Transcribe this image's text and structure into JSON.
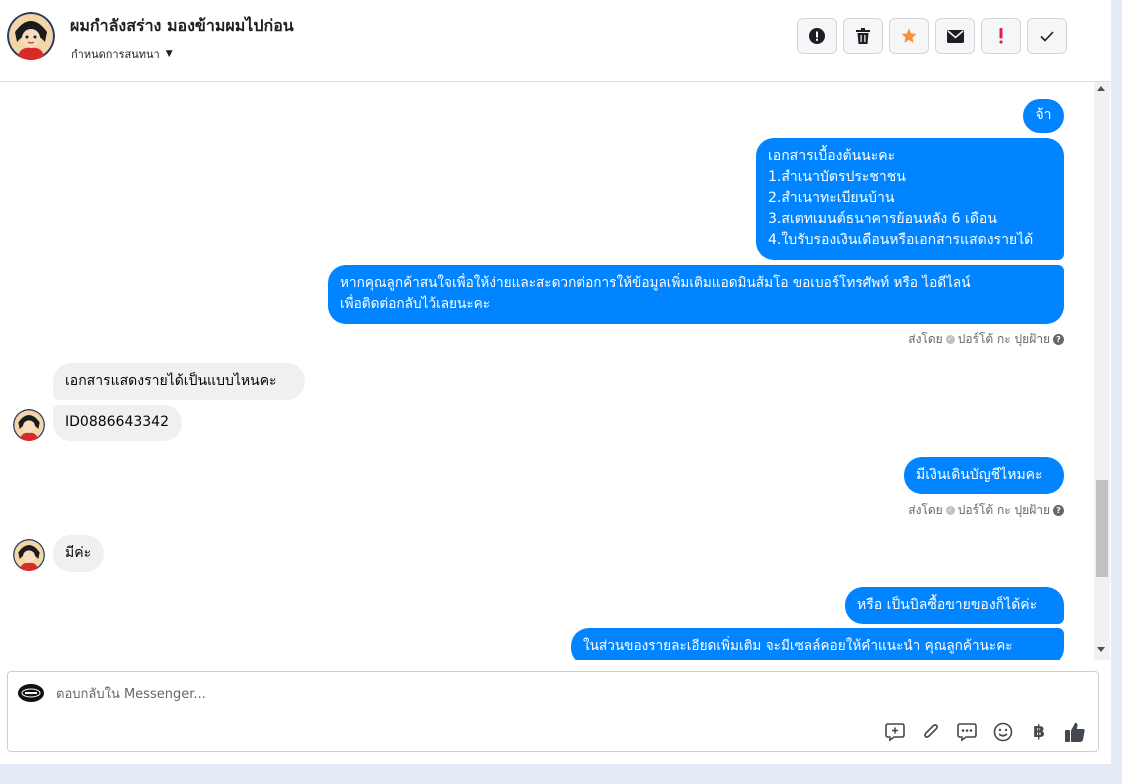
{
  "header": {
    "title": "ผมกำลังสร่าง มองข้ามผมไปก่อน",
    "subtitle": "กำหนดการสนทนา"
  },
  "messages": {
    "m1": "จ้า",
    "m2": [
      "เอกสารเบื้องต้นนะคะ",
      "1.สำเนาบัตรประชาชน",
      "2.สำเนาทะเบียนบ้าน",
      "3.สเตทเมนต์ธนาคารย้อนหลัง 6 เดือน",
      "4.ใบรับรองเงินเดือนหรือเอกสารแสดงรายได้"
    ],
    "m3": [
      "หากคุณลูกค้าสนใจเพื่อให้ง่ายและสะดวกต่อการให้ข้อมูลเพิ่มเติมแอดมินส้มโอ ขอเบอร์โทรศัพท์ หรือ ไอดีไลน์",
      "เพื่อติดต่อกลับไว้เลยนะคะ"
    ],
    "sent_by_1": {
      "prefix": "ส่งโดย",
      "name": "ปอร์โต้ กะ ปุยฝ้าย"
    },
    "m4": "เอกสารแสดงรายได้เป็นแบบไหนคะ",
    "m5": "ID0886643342",
    "m6": "มีเงินเดินบัญชีไหมคะ",
    "sent_by_2": {
      "prefix": "ส่งโดย",
      "name": "ปอร์โต้ กะ ปุยฝ้าย"
    },
    "m7": "มีค่ะ",
    "m8": "หรือ เป็นบิลซื้อขายของก็ได้ค่ะ",
    "m9": "ในส่วนของรายละเอียดเพิ่มเติม จะมีเซลล์คอยให้คำแนะนำ คุณลูกค้านะคะ"
  },
  "composer": {
    "placeholder": "ตอบกลับใน Messenger...",
    "baht_symbol": "฿"
  },
  "colors": {
    "outgoing_bubble": "#0084ff",
    "incoming_bubble": "#f0f0f0",
    "star": "#f7923b",
    "alert": "#e41e3f"
  }
}
